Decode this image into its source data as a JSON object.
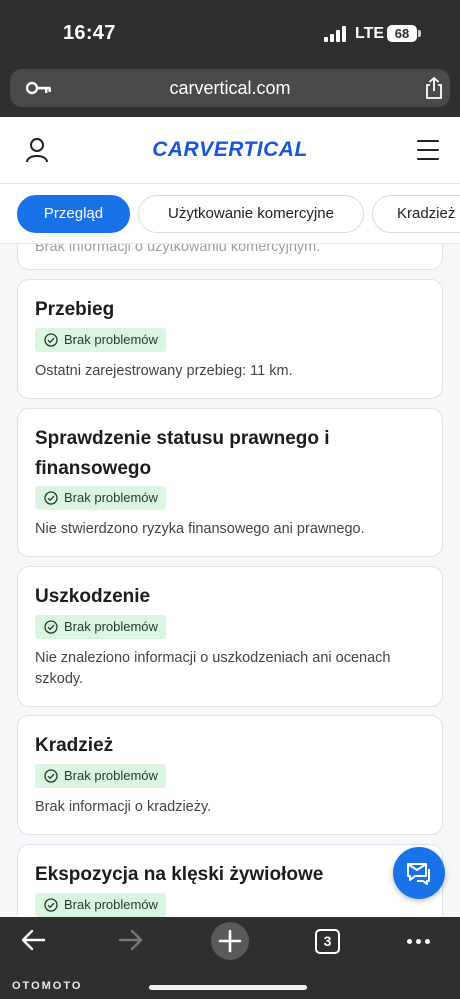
{
  "status_bar": {
    "time": "16:47",
    "network": "LTE",
    "battery": "68"
  },
  "browser": {
    "url": "carvertical.com"
  },
  "site": {
    "logo": "CARVERTICAL"
  },
  "tabs": [
    {
      "label": "Przegląd",
      "active": true
    },
    {
      "label": "Użytkowanie komercyjne",
      "active": false
    },
    {
      "label": "Kradzież",
      "active": false
    }
  ],
  "partial_card_text": "Brak informacji o użytkowaniu komercyjnym.",
  "cards": [
    {
      "title": "Przebieg",
      "badge": "Brak problemów",
      "description": "Ostatni zarejestrowany przebieg: 11 km."
    },
    {
      "title_line1": "Sprawdzenie statusu prawnego i",
      "title_line2": "finansowego",
      "badge": "Brak problemów",
      "description": "Nie stwierdzono ryzyka finansowego ani prawnego."
    },
    {
      "title": "Uszkodzenie",
      "badge": "Brak problemów",
      "description_line1": "Nie znaleziono informacji o uszkodzeniach ani ocenach",
      "description_line2": "szkody."
    },
    {
      "title": "Kradzież",
      "badge": "Brak problemów",
      "description": "Brak informacji o kradzieży."
    },
    {
      "title": "Ekspozycja na klęski żywiołowe",
      "badge": "Brak problemów"
    }
  ],
  "toolbar": {
    "tabs_count": "3"
  },
  "watermark": "OTOMOTO",
  "colors": {
    "accent": "#1a72e8",
    "badge_bg": "#dcf5e3"
  }
}
